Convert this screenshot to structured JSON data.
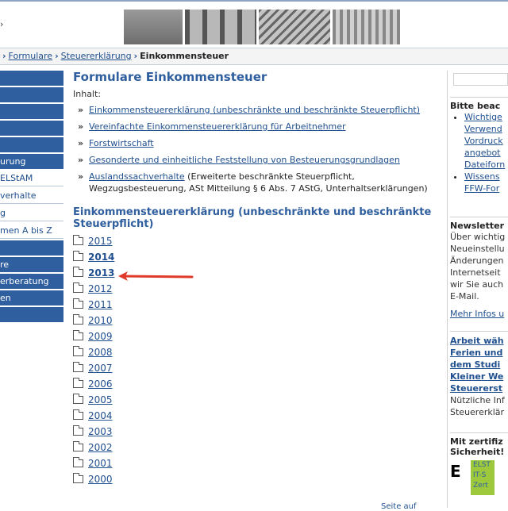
{
  "header": {
    "logo_glyph": "›"
  },
  "breadcrumb": {
    "items": [
      "Formulare",
      "Steuererklärung"
    ],
    "current": "Einkommensteuer"
  },
  "sidebar": {
    "items": [
      {
        "label": "",
        "style": "dark"
      },
      {
        "label": "",
        "style": "dark"
      },
      {
        "label": "",
        "style": "dark"
      },
      {
        "label": "",
        "style": "dark"
      },
      {
        "label": "",
        "style": "dark"
      },
      {
        "label": "urung",
        "style": "dark"
      },
      {
        "label": "ELStAM",
        "style": "light"
      },
      {
        "label": "verhalte",
        "style": "light"
      },
      {
        "label": "g",
        "style": "light"
      },
      {
        "label": "men A bis Z",
        "style": "light"
      },
      {
        "label": "",
        "style": "dark"
      },
      {
        "label": "re",
        "style": "dark"
      },
      {
        "label": "erberatung",
        "style": "dark"
      },
      {
        "label": "en",
        "style": "dark"
      },
      {
        "label": "",
        "style": "dark"
      }
    ]
  },
  "main": {
    "title": "Formulare Einkommensteuer",
    "inhalt_label": "Inhalt:",
    "toc": [
      {
        "link": "Einkommensteuererklärung (unbeschränkte und beschränkte Steuerpflicht)",
        "text": ""
      },
      {
        "link": "Vereinfachte Einkommensteuererklärung für Arbeitnehmer",
        "text": ""
      },
      {
        "link": "Forstwirtschaft",
        "text": ""
      },
      {
        "link": "Gesonderte und einheitliche Feststellung von Besteuerungsgrundlagen",
        "text": ""
      },
      {
        "link": "Auslandssachverhalte",
        "text": " (Erweiterte beschränkte Steuerpflicht, Wegzugsbesteuerung, ASt Mitteilung § 6 Abs. 7 AStG, Unterhaltserklärungen)"
      }
    ],
    "section_title": "Einkommensteuererklärung (unbeschränkte und beschränkte Steuerpflicht)",
    "years": [
      {
        "label": "2015",
        "bold": false
      },
      {
        "label": "2014",
        "bold": true
      },
      {
        "label": "2013",
        "bold": true
      },
      {
        "label": "2012",
        "bold": false
      },
      {
        "label": "2011",
        "bold": false
      },
      {
        "label": "2010",
        "bold": false
      },
      {
        "label": "2009",
        "bold": false
      },
      {
        "label": "2008",
        "bold": false
      },
      {
        "label": "2007",
        "bold": false
      },
      {
        "label": "2006",
        "bold": false
      },
      {
        "label": "2005",
        "bold": false
      },
      {
        "label": "2004",
        "bold": false
      },
      {
        "label": "2003",
        "bold": false
      },
      {
        "label": "2002",
        "bold": false
      },
      {
        "label": "2001",
        "bold": false
      },
      {
        "label": "2000",
        "bold": false
      }
    ],
    "arrow_color": "#e03a2a"
  },
  "right": {
    "box1": {
      "title": "Bitte beac",
      "items": [
        {
          "lines": [
            "Wichtige",
            "Verwend",
            "Vordruck",
            "angebot",
            "Dateiforn"
          ]
        },
        {
          "lines": [
            "Wissens",
            "FFW-For"
          ]
        }
      ]
    },
    "box2": {
      "title": "Newsletter",
      "lines": [
        "Über wichtig",
        "Neueinstellu",
        "Änderungen",
        "Internetseit",
        "wir Sie auch",
        "E-Mail."
      ],
      "more": "Mehr Infos u"
    },
    "box3": {
      "links": [
        "Arbeit wäh",
        "Ferien und",
        "dem Studi",
        "Kleiner We",
        "Steuererst"
      ],
      "lines": [
        "Nützliche Inf",
        "Steuererklär"
      ]
    },
    "box4": {
      "title_lines": [
        "Mit zertifiz",
        "Sicherheit!"
      ],
      "e_glyph": "E",
      "seal_lines": [
        "ELST",
        "IT-S",
        "Zert"
      ]
    }
  },
  "footer": {
    "partial": "Seite auf"
  },
  "colors": {
    "nav_dark": "#2f5f9e",
    "link": "#1f4f8f",
    "heading": "#2f5f9e"
  }
}
